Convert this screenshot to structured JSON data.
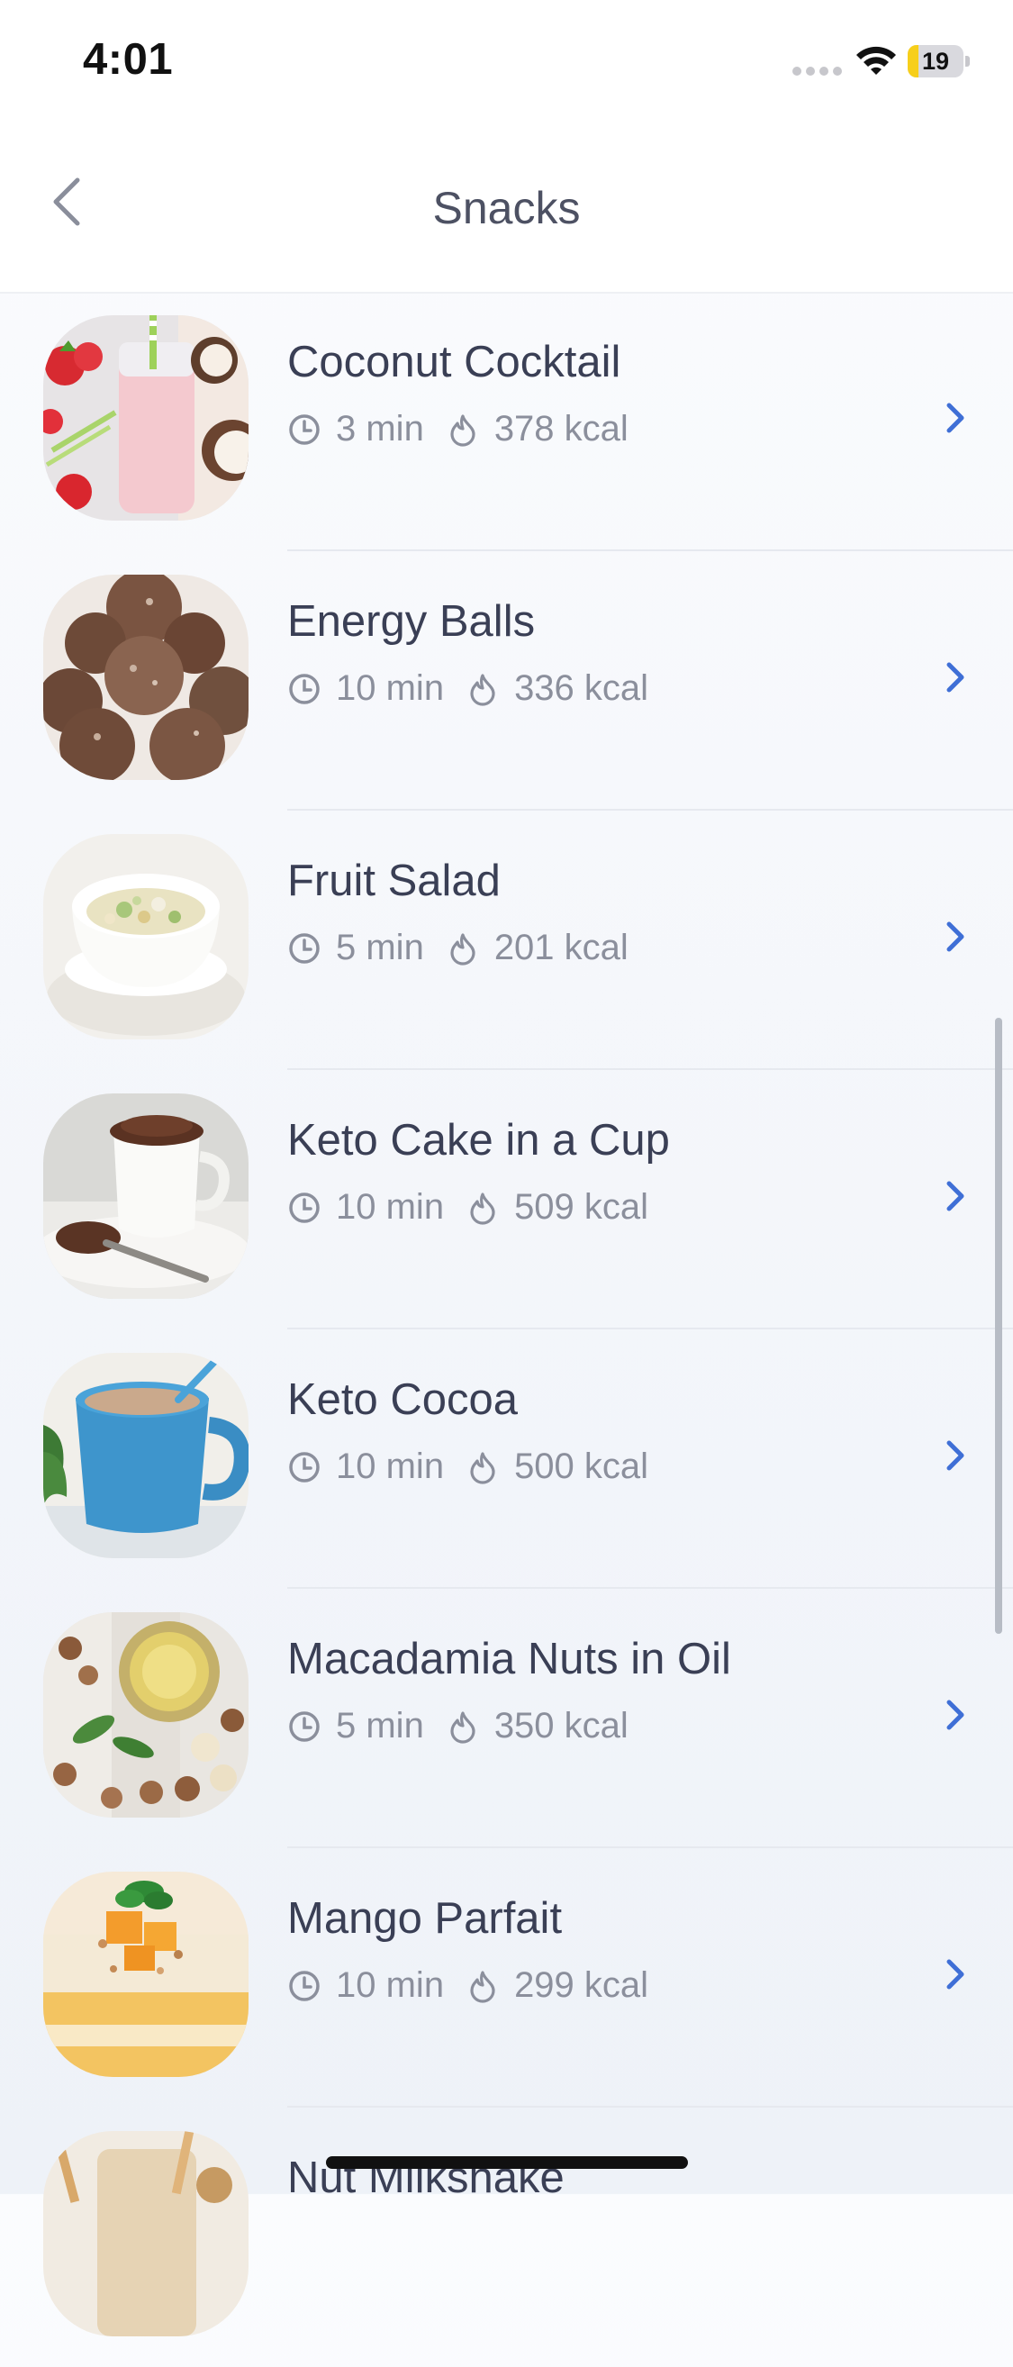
{
  "status_bar": {
    "time": "4:01",
    "battery_level": "19",
    "battery_fraction": 0.19,
    "icons": [
      "signal-dots-icon",
      "wifi-icon",
      "battery-icon"
    ]
  },
  "nav": {
    "title": "Snacks",
    "back_icon": "chevron-left-icon"
  },
  "colors": {
    "accent": "#3f6fd6",
    "title_text": "#3a3f55",
    "meta_text": "#8b8f9c",
    "battery_low": "#f7cf1b"
  },
  "recipes": [
    {
      "name": "Coconut Cocktail",
      "time": "3 min",
      "kcal": "378 kcal",
      "thumb": "coconut-cocktail-photo"
    },
    {
      "name": "Energy Balls",
      "time": "10 min",
      "kcal": "336 kcal",
      "thumb": "energy-balls-photo"
    },
    {
      "name": "Fruit Salad",
      "time": "5 min",
      "kcal": "201 kcal",
      "thumb": "fruit-salad-photo"
    },
    {
      "name": "Keto Cake in a Cup",
      "time": "10 min",
      "kcal": "509 kcal",
      "thumb": "keto-cake-cup-photo"
    },
    {
      "name": "Keto Cocoa",
      "time": "10 min",
      "kcal": "500 kcal",
      "thumb": "keto-cocoa-photo"
    },
    {
      "name": "Macadamia Nuts in Oil",
      "time": "5 min",
      "kcal": "350 kcal",
      "thumb": "macadamia-nuts-photo"
    },
    {
      "name": "Mango Parfait",
      "time": "10 min",
      "kcal": "299 kcal",
      "thumb": "mango-parfait-photo"
    },
    {
      "name": "Nut Milkshake",
      "time": "",
      "kcal": "",
      "thumb": "nut-milkshake-photo"
    }
  ],
  "row_icons": {
    "time_icon": "clock-icon",
    "calories_icon": "flame-icon",
    "chevron_icon": "chevron-right-icon"
  }
}
